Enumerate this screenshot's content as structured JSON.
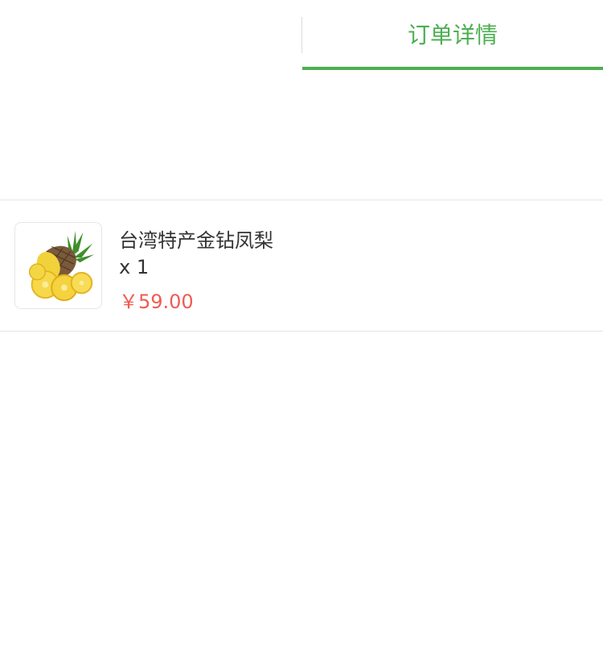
{
  "tabs": {
    "active_label": "订单详情"
  },
  "order_item": {
    "name": "台湾特产金钻凤梨",
    "quantity": "x 1",
    "price": "￥59.00",
    "image_icon": "pineapple-image"
  },
  "colors": {
    "accent": "#4caf50",
    "price": "#f25a52",
    "text": "#333333",
    "divider": "#e5e5e5"
  }
}
